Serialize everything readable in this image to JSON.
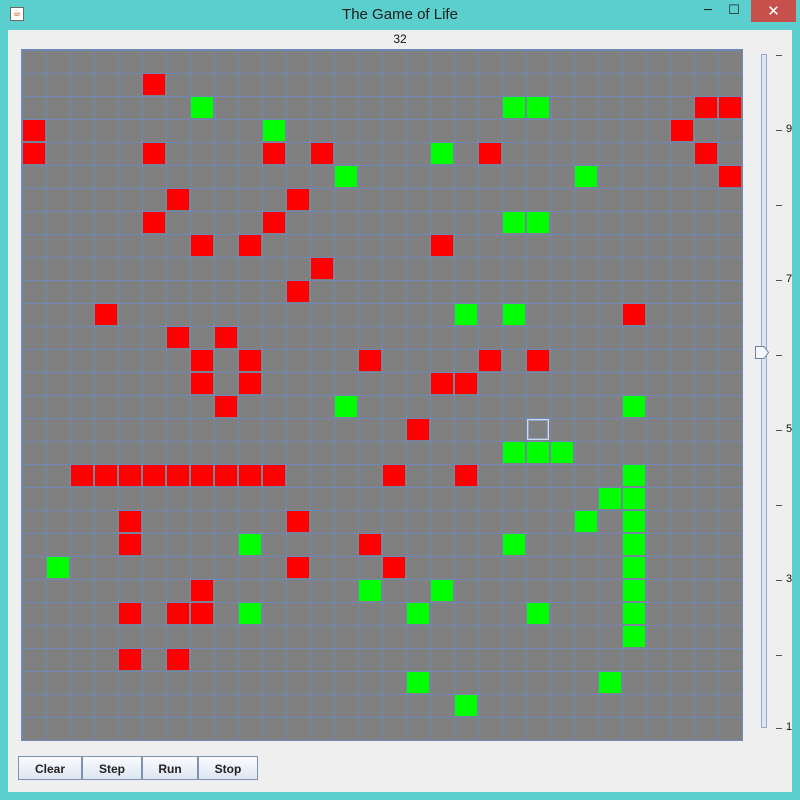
{
  "window": {
    "title": "The Game of Life",
    "icon": "java-cup-icon",
    "controls": {
      "minimize": "─",
      "maximize": "☐",
      "close": "✕"
    }
  },
  "generation": "32",
  "board": {
    "cols": 30,
    "rows": 30,
    "colors": {
      "red": "#ff0000",
      "green": "#00ff00",
      "dead": "#808080",
      "grid": "#6f88b6"
    },
    "red_cells": [
      [
        5,
        1
      ],
      [
        28,
        2
      ],
      [
        29,
        2
      ],
      [
        0,
        3
      ],
      [
        27,
        3
      ],
      [
        0,
        4
      ],
      [
        5,
        4
      ],
      [
        10,
        4
      ],
      [
        12,
        4
      ],
      [
        19,
        4
      ],
      [
        28,
        4
      ],
      [
        29,
        5
      ],
      [
        6,
        6
      ],
      [
        11,
        6
      ],
      [
        5,
        7
      ],
      [
        10,
        7
      ],
      [
        7,
        8
      ],
      [
        9,
        8
      ],
      [
        17,
        8
      ],
      [
        12,
        9
      ],
      [
        11,
        10
      ],
      [
        3,
        11
      ],
      [
        25,
        11
      ],
      [
        6,
        12
      ],
      [
        8,
        12
      ],
      [
        7,
        13
      ],
      [
        9,
        13
      ],
      [
        14,
        13
      ],
      [
        19,
        13
      ],
      [
        21,
        13
      ],
      [
        7,
        14
      ],
      [
        9,
        14
      ],
      [
        17,
        14
      ],
      [
        18,
        14
      ],
      [
        8,
        15
      ],
      [
        16,
        16
      ],
      [
        2,
        18
      ],
      [
        3,
        18
      ],
      [
        4,
        18
      ],
      [
        5,
        18
      ],
      [
        6,
        18
      ],
      [
        7,
        18
      ],
      [
        8,
        18
      ],
      [
        9,
        18
      ],
      [
        10,
        18
      ],
      [
        15,
        18
      ],
      [
        18,
        18
      ],
      [
        4,
        20
      ],
      [
        11,
        20
      ],
      [
        4,
        21
      ],
      [
        14,
        21
      ],
      [
        11,
        22
      ],
      [
        15,
        22
      ],
      [
        7,
        23
      ],
      [
        4,
        24
      ],
      [
        6,
        24
      ],
      [
        7,
        24
      ],
      [
        4,
        26
      ],
      [
        6,
        26
      ]
    ],
    "green_cells": [
      [
        7,
        2
      ],
      [
        20,
        2
      ],
      [
        21,
        2
      ],
      [
        10,
        3
      ],
      [
        17,
        4
      ],
      [
        13,
        5
      ],
      [
        23,
        5
      ],
      [
        20,
        7
      ],
      [
        21,
        7
      ],
      [
        18,
        11
      ],
      [
        20,
        11
      ],
      [
        13,
        15
      ],
      [
        25,
        15
      ],
      [
        20,
        17
      ],
      [
        21,
        17
      ],
      [
        22,
        17
      ],
      [
        25,
        18
      ],
      [
        24,
        19
      ],
      [
        25,
        19
      ],
      [
        23,
        20
      ],
      [
        25,
        20
      ],
      [
        9,
        21
      ],
      [
        20,
        21
      ],
      [
        25,
        21
      ],
      [
        1,
        22
      ],
      [
        25,
        22
      ],
      [
        14,
        23
      ],
      [
        17,
        23
      ],
      [
        25,
        23
      ],
      [
        9,
        24
      ],
      [
        16,
        24
      ],
      [
        21,
        24
      ],
      [
        25,
        24
      ],
      [
        25,
        25
      ],
      [
        16,
        27
      ],
      [
        24,
        27
      ],
      [
        18,
        28
      ]
    ],
    "cursor_cell": [
      21,
      16
    ]
  },
  "slider": {
    "min": 1,
    "max": 10,
    "value": 6,
    "labels": [
      "9",
      "7",
      "5",
      "3",
      "1"
    ]
  },
  "buttons": {
    "clear": "Clear",
    "step": "Step",
    "run": "Run",
    "stop": "Stop"
  }
}
